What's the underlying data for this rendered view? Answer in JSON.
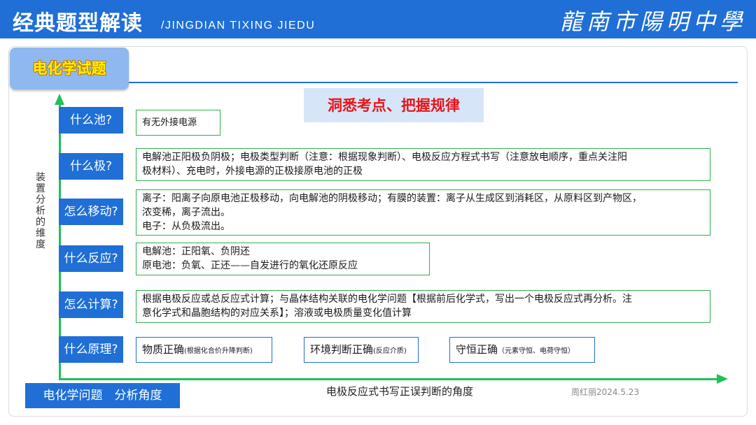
{
  "header": {
    "title": "经典题型解读",
    "subtitle": "/JINGDIAN TIXING JIEDU",
    "school_logo": "龍南市陽明中學",
    "background_color": "#1f6fd6"
  },
  "topic": {
    "label": "电化学试题"
  },
  "motto": "洞悉考点、把握规律",
  "y_axis_label": "装置分析的维度",
  "rows": [
    {
      "question": "什么池?",
      "answer_lines": [
        "有无外接电源"
      ]
    },
    {
      "question": "什么极?",
      "answer_lines": [
        "电解池正阳极负阴极；电极类型判断（注意：根据现象判断）、电极反应方程式书写（注意放电顺序，重点关注阳",
        "极材料）、充电时，外接电源的正极接原电池的正极"
      ]
    },
    {
      "question": "怎么移动?",
      "answer_lines": [
        "离子：阳离子向原电池正极移动，向电解池的阴极移动；有膜的装置：离子从生成区到消耗区，从原料区到产物区，",
        "浓变稀，离子流出。",
        "电子：从负极流出。"
      ]
    },
    {
      "question": "什么反应?",
      "answer_lines": [
        "电解池：正阳氧、负阴还",
        "原电池：负氧、正还——自发进行的氧化还原反应"
      ]
    },
    {
      "question": "怎么计算?",
      "answer_lines": [
        "根据电极反应或总反应式计算；与晶体结构关联的电化学问题【根据前后化学式，写出一个电极反应式再分析。注",
        "意化学式和晶胞结构的对应关系】；溶液或电极质量变化值计算"
      ]
    },
    {
      "question": "什么原理?"
    }
  ],
  "principles": [
    {
      "main": "物质正确",
      "note": "(根据化合价升降判断)"
    },
    {
      "main": "环境判断正确",
      "note": "(反应介质)"
    },
    {
      "main": "守恒正确",
      "note": "（元素守恒、电荷守恒）"
    }
  ],
  "footer": {
    "category_label": "电化学问题　分析角度",
    "x_axis_label": "电极反应式书写正误判断的角度",
    "author": "周红丽2024.5.23"
  },
  "colors": {
    "accent_blue": "#1f6fd6",
    "axis_green": "#20c05a",
    "box_border_green": "#2fb14c",
    "motto_red": "#e8141b",
    "topic_yellow": "#fff200"
  }
}
